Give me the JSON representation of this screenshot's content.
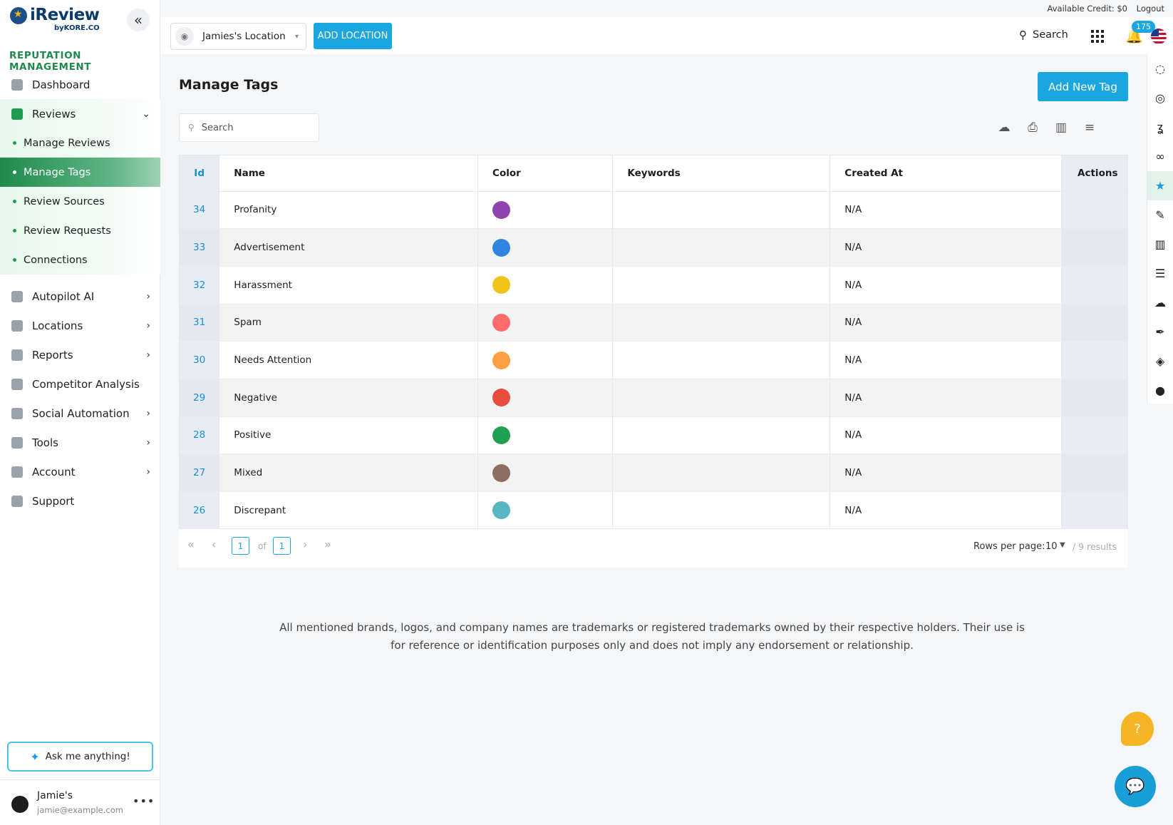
{
  "brand": {
    "name": "iReview",
    "byline": "byKORE.CO"
  },
  "sidebar": {
    "section_title": "REPUTATION MANAGEMENT",
    "items": [
      {
        "label": "Dashboard",
        "icon": "dashboard-icon"
      },
      {
        "label": "Reviews",
        "icon": "reviews-icon",
        "expanded": true,
        "children": [
          "Manage Reviews",
          "Manage Tags",
          "Review Sources",
          "Review Requests",
          "Connections"
        ],
        "active_child": "Manage Tags"
      },
      {
        "label": "Autopilot AI",
        "icon": "ai-icon"
      },
      {
        "label": "Locations",
        "icon": "location-icon"
      },
      {
        "label": "Reports",
        "icon": "reports-icon"
      },
      {
        "label": "Competitor Analysis",
        "icon": "competitor-icon"
      },
      {
        "label": "Social Automation",
        "icon": "social-icon"
      },
      {
        "label": "Tools",
        "icon": "gear-icon"
      },
      {
        "label": "Account",
        "icon": "account-icon"
      },
      {
        "label": "Support",
        "icon": "help-icon"
      }
    ],
    "ask_label": "Ask me anything!",
    "user": {
      "name": "Jamie's",
      "email": "jamie@example.com"
    }
  },
  "topstrip": {
    "credit": "Available Credit: $0",
    "logout": "Logout"
  },
  "topbar": {
    "location": "Jamies's Location",
    "add_location": "ADD LOCATION",
    "search": "Search",
    "notifications": "175"
  },
  "main": {
    "title": "Manage Tags",
    "add_button": "Add New Tag",
    "search_placeholder": "Search",
    "columns": [
      "Id",
      "Name",
      "Color",
      "Keywords",
      "Created At",
      "Actions"
    ],
    "rows": [
      {
        "id": "34",
        "name": "Profanity",
        "color": "#8e44ad",
        "keywords": "",
        "created": "N/A"
      },
      {
        "id": "33",
        "name": "Advertisement",
        "color": "#2e86de",
        "keywords": "",
        "created": "N/A"
      },
      {
        "id": "32",
        "name": "Harassment",
        "color": "#f0c419",
        "keywords": "",
        "created": "N/A"
      },
      {
        "id": "31",
        "name": "Spam",
        "color": "#ff6b6b",
        "keywords": "",
        "created": "N/A"
      },
      {
        "id": "30",
        "name": "Needs Attention",
        "color": "#ff9f43",
        "keywords": "",
        "created": "N/A"
      },
      {
        "id": "29",
        "name": "Negative",
        "color": "#e74c3c",
        "keywords": "",
        "created": "N/A"
      },
      {
        "id": "28",
        "name": "Positive",
        "color": "#1fa050",
        "keywords": "",
        "created": "N/A"
      },
      {
        "id": "27",
        "name": "Mixed",
        "color": "#8d6e63",
        "keywords": "",
        "created": "N/A"
      },
      {
        "id": "26",
        "name": "Discrepant",
        "color": "#56b6c2",
        "keywords": "",
        "created": "N/A"
      }
    ],
    "pager": {
      "page": "1",
      "of": "of",
      "total_pages": "1",
      "rows_label": "Rows per page:",
      "rows_value": "10",
      "results": "/ 9 results"
    }
  },
  "disclaimer": "All mentioned brands, logos, and company names are trademarks or registered trademarks owned by their respective holders. Their use is for reference or identification purposes only and does not imply any endorsement or relationship."
}
